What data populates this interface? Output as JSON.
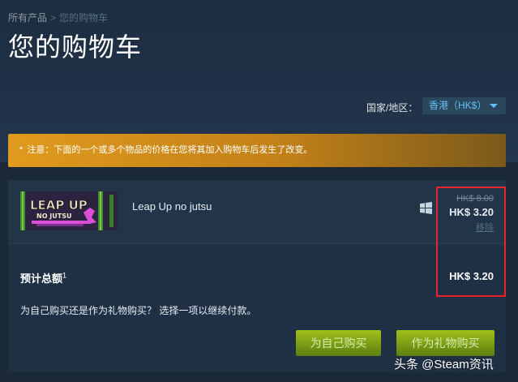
{
  "breadcrumb": {
    "root": "所有产品",
    "separator": ">",
    "current": "您的购物车"
  },
  "page_title": "您的购物车",
  "region": {
    "label": "国家/地区：",
    "selected": "香港（HK$）"
  },
  "notice": {
    "icon": "*",
    "text": "注意：下面的一个或多个物品的价格在您将其加入购物车后发生了改变。"
  },
  "cart_item": {
    "thumbnail_title": "LEAP UP",
    "thumbnail_subtitle": "NO JUTSU",
    "name": "Leap Up no jutsu",
    "platform_icon": "windows-icon",
    "original_price": "HK$ 8.00",
    "price": "HK$ 3.20",
    "remove_label": "移除"
  },
  "totals": {
    "label": "预计总额",
    "footnote": "1",
    "amount": "HK$ 3.20",
    "prompt": "为自己购买还是作为礼物购买？ 选择一项以继续付款。"
  },
  "buttons": {
    "buy_self": "为自己购买",
    "buy_gift": "作为礼物购买"
  },
  "watermark": "头条 @Steam资讯",
  "colors": {
    "accent_blue": "#67c1f5",
    "notice_orange": "#e09a1d",
    "button_green": "#75b022",
    "highlight_red": "#e8232b"
  }
}
